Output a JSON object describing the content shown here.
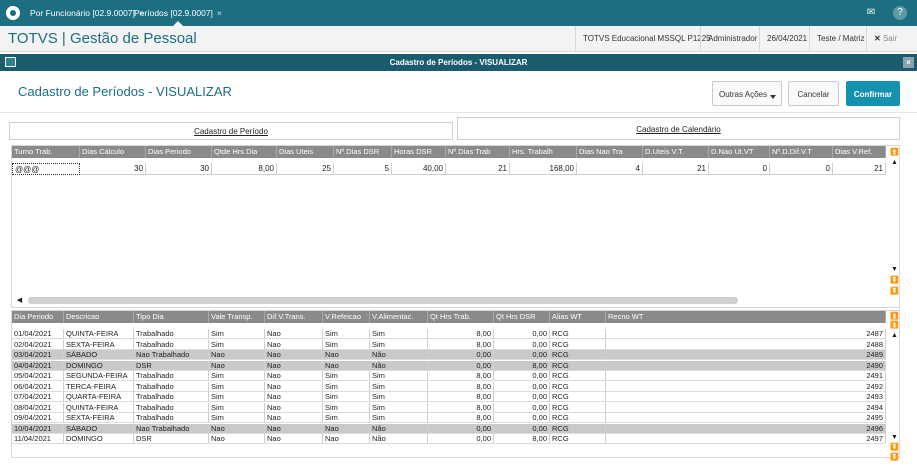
{
  "tabs": [
    {
      "label": "Por Funcionário [02.9.0007]",
      "close": "×"
    },
    {
      "label": "Períodos [02.9.0007]",
      "close": "×"
    }
  ],
  "topbar_icons": {
    "mail": "✉",
    "help": "?"
  },
  "app": {
    "title": "TOTVS | Gestão de Pessoal",
    "environment": "TOTVS Educacional MSSQL P1225",
    "user": "Administrador",
    "date": "26/04/2021",
    "company": "Teste / Matriz",
    "exit_icon": "✕",
    "exit_label": "Sair"
  },
  "dialog": {
    "bar_title": "Cadastro de Períodos - VISUALIZAR",
    "close": "×",
    "title": "Cadastro de Períodos - VISUALIZAR",
    "buttons": {
      "other": "Outras Ações",
      "cancel": "Cancelar",
      "confirm": "Confirmar"
    }
  },
  "folders": [
    "Cadastro de Período",
    "Cadastro de Calendário"
  ],
  "period_grid": {
    "headers": [
      "Turno Trab.",
      "Dias Cálculo",
      "Dias Periodo",
      "Qtde Hrs Dia",
      "Dias Uteis",
      "Nº.Dias DSR",
      "Horas DSR",
      "Nº.Dias Trab",
      "Hrs. Trabalh",
      "Dias Nao Tra",
      "D.Uteis V.T.",
      "D.Nao Ut.VT",
      "Nº.D.Dif.V.T",
      "Dias V.Ref."
    ],
    "row": [
      "@@@",
      "30",
      "30",
      "8,00",
      "25",
      "5",
      "40,00",
      "21",
      "168,00",
      "4",
      "21",
      "0",
      "0",
      "21"
    ]
  },
  "calendar_grid": {
    "headers": [
      "Dia Periodo",
      "Descricao",
      "Tipo Dia",
      "Vale Transp.",
      "Dif.V.Trans.",
      "V.Refeicao",
      "V.Alimentac.",
      "Qt Hrs Trab.",
      "Qt Hrs DSR",
      "Alias WT",
      "Recno WT"
    ],
    "rows": [
      [
        "01/04/2021",
        "QUINTA-FEIRA",
        "Trabalhado",
        "Sim",
        "Nao",
        "Sim",
        "Sim",
        "8,00",
        "0,00",
        "RCG",
        "2487"
      ],
      [
        "02/04/2021",
        "SEXTA-FEIRA",
        "Trabalhado",
        "Sim",
        "Nao",
        "Sim",
        "Sim",
        "8,00",
        "0,00",
        "RCG",
        "2488"
      ],
      [
        "03/04/2021",
        "SÁBADO",
        "Nao Trabalhado",
        "Nao",
        "Nao",
        "Nao",
        "Não",
        "0,00",
        "0,00",
        "RCG",
        "2489"
      ],
      [
        "04/04/2021",
        "DOMINGO",
        "DSR",
        "Nao",
        "Nao",
        "Nao",
        "Não",
        "0,00",
        "8,00",
        "RCG",
        "2490"
      ],
      [
        "05/04/2021",
        "SEGUNDA-FEIRA",
        "Trabalhado",
        "Sim",
        "Nao",
        "Sim",
        "Sim",
        "8,00",
        "0,00",
        "RCG",
        "2491"
      ],
      [
        "06/04/2021",
        "TERCA-FEIRA",
        "Trabalhado",
        "Sim",
        "Nao",
        "Sim",
        "Sim",
        "8,00",
        "0,00",
        "RCG",
        "2492"
      ],
      [
        "07/04/2021",
        "QUARTA-FEIRA",
        "Trabalhado",
        "Sim",
        "Nao",
        "Sim",
        "Sim",
        "8,00",
        "0,00",
        "RCG",
        "2493"
      ],
      [
        "08/04/2021",
        "QUINTA-FEIRA",
        "Trabalhado",
        "Sim",
        "Nao",
        "Sim",
        "Sim",
        "8,00",
        "0,00",
        "RCG",
        "2494"
      ],
      [
        "09/04/2021",
        "SEXTA-FEIRA",
        "Trabalhado",
        "Sim",
        "Nao",
        "Sim",
        "Sim",
        "8,00",
        "0,00",
        "RCG",
        "2495"
      ],
      [
        "10/04/2021",
        "SÁBADO",
        "Nao Trabalhado",
        "Nao",
        "Nao",
        "Nao",
        "Não",
        "0,00",
        "0,00",
        "RCG",
        "2496"
      ],
      [
        "11/04/2021",
        "DOMINGO",
        "DSR",
        "Nao",
        "Nao",
        "Nao",
        "Não",
        "0,00",
        "8,00",
        "RCG",
        "2497"
      ]
    ]
  },
  "nav_icons": {
    "first": "⏫",
    "up": "▲",
    "down": "▼",
    "last": "⏬",
    "left": "◀"
  },
  "colors": {
    "brand": "#1b6f80",
    "primary_button": "#1591b0",
    "grid_header": "#8a8a8a",
    "selected_row": "#c9c9c9"
  }
}
